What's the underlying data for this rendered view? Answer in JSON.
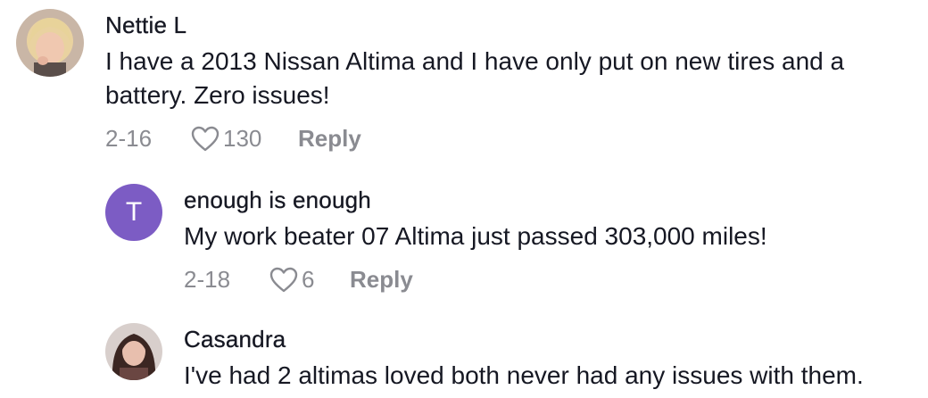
{
  "comments": [
    {
      "username": "Nettie L",
      "text": "I have a 2013 Nissan Altima and I have only put on new tires and a battery. Zero issues!",
      "date": "2-16",
      "likes": "130",
      "reply_label": "Reply",
      "avatar": "photo"
    },
    {
      "username": "enough is enough",
      "text": "My work beater 07 Altima just passed 303,000 miles!",
      "date": "2-18",
      "likes": "6",
      "reply_label": "Reply",
      "avatar_letter": "T",
      "avatar_color": "#7c5cc4"
    },
    {
      "username": "Casandra",
      "text": "I've had 2 altimas loved both never had any issues with them.",
      "avatar": "photo"
    }
  ],
  "colors": {
    "text": "#161823",
    "meta": "#8a8b91"
  },
  "icons": {
    "like": "heart-outline-icon"
  }
}
